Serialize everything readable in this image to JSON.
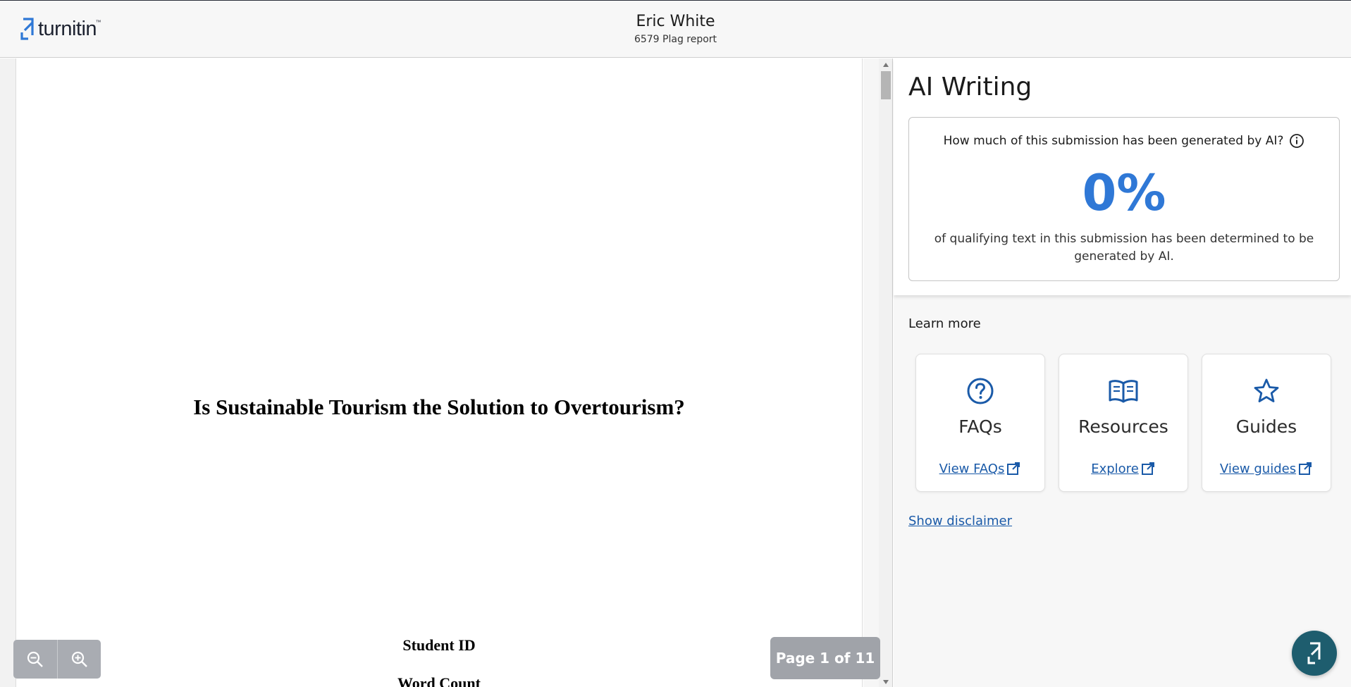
{
  "header": {
    "logo_text": "turnitin",
    "logo_tm": "™",
    "owner_name": "Eric White",
    "subtitle": "6579 Plag report"
  },
  "document": {
    "title": "Is Sustainable Tourism the Solution to Overtourism?",
    "line_1": "Student ID",
    "line_2": "Word Count"
  },
  "viewer": {
    "page_indicator": "Page 1 of 11",
    "zoom_out_icon": "zoom-out-icon",
    "zoom_in_icon": "zoom-in-icon"
  },
  "panel": {
    "title": "AI Writing",
    "question": "How much of this submission has been generated by AI?",
    "percent": "0%",
    "description": "of qualifying text in this submission has been determined to be generated by AI.",
    "learn_more": "Learn more",
    "resources": [
      {
        "icon": "question-circle-icon",
        "title": "FAQs",
        "link": "View FAQs"
      },
      {
        "icon": "open-book-icon",
        "title": "Resources",
        "link": "Explore"
      },
      {
        "icon": "star-icon",
        "title": "Guides",
        "link": "View guides"
      }
    ],
    "disclaimer": "Show disclaimer"
  },
  "colors": {
    "accent_blue": "#2f78d6",
    "link_blue": "#1a5aa8",
    "help_button": "#1e5d6e"
  }
}
